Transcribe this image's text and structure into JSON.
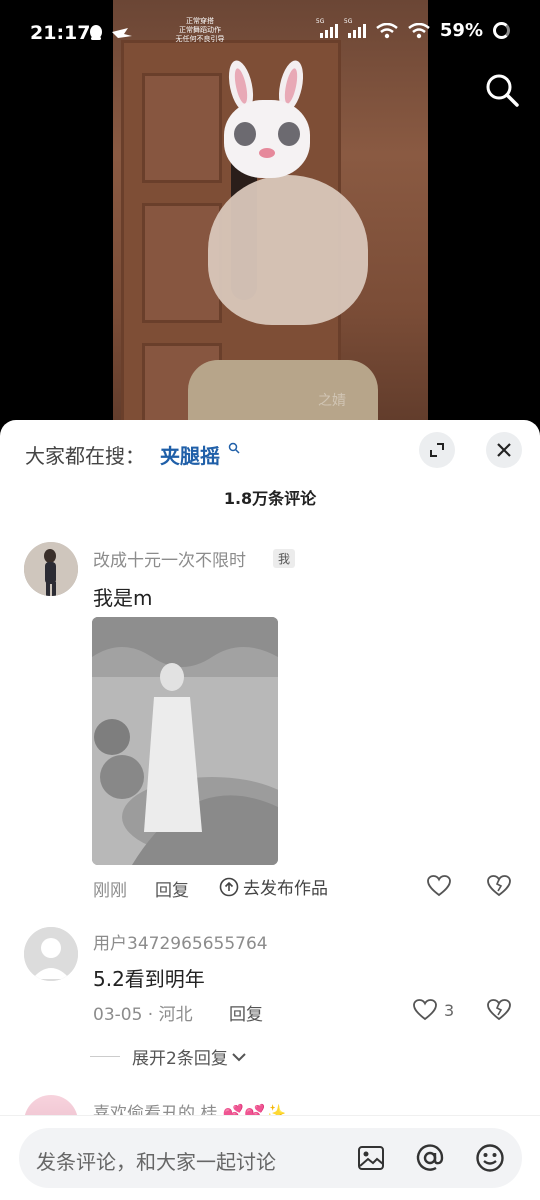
{
  "status_bar": {
    "time": "21:17",
    "notice_lines": [
      "正常穿搭",
      "正常舞蹈动作",
      "无任何不良引导"
    ],
    "network_1": "5G",
    "network_2": "5G",
    "battery": "59%"
  },
  "video": {
    "watermark": "之婧"
  },
  "panel": {
    "searching_label": "大家都在搜：",
    "searching_term": "夹腿摇",
    "comment_count": "1.8万条评论"
  },
  "comments": [
    {
      "username": "改成十元一次不限时",
      "tag": "我",
      "text": "我是m",
      "time": "刚刚",
      "reply_label": "回复",
      "publish_label": "去发布作品"
    },
    {
      "username": "用户3472965655764",
      "text": "5.2看到明年",
      "time": "03-05 · 河北",
      "reply_label": "回复",
      "like_count": "3",
      "expand_label": "展开2条回复"
    },
    {
      "username": "喜欢偷看丑的 桂"
    }
  ],
  "input": {
    "placeholder": "发条评论，和大家一起讨论"
  },
  "colors": {
    "link_blue": "#1f5fa8",
    "muted_gray": "#8c8c8c",
    "panel_bg": "#ffffff"
  }
}
